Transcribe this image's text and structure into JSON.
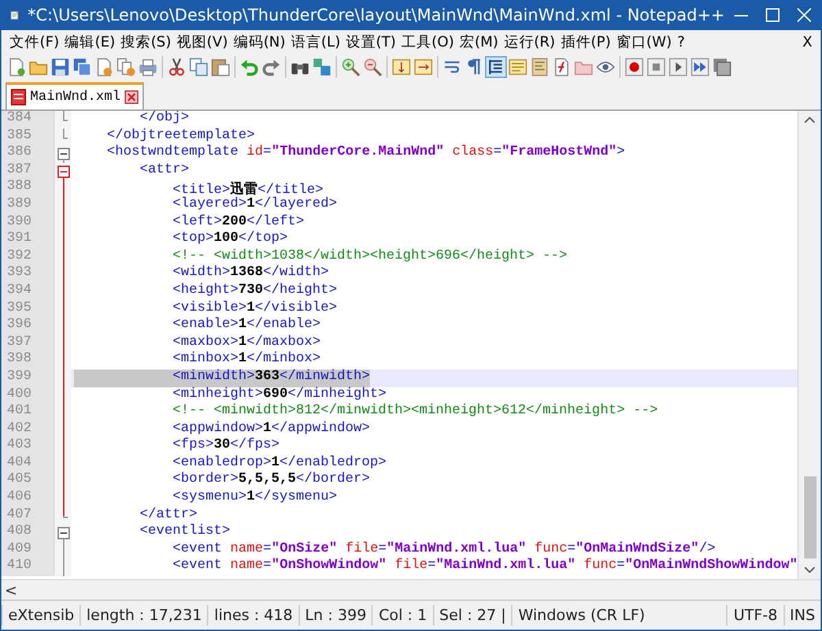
{
  "window": {
    "title": "*C:\\Users\\Lenovo\\Desktop\\ThunderCore\\layout\\MainWnd\\MainWnd.xml - Notepad++"
  },
  "menu": {
    "items": [
      {
        "label": "文件(F)"
      },
      {
        "label": "编辑(E)"
      },
      {
        "label": "搜索(S)"
      },
      {
        "label": "视图(V)"
      },
      {
        "label": "编码(N)"
      },
      {
        "label": "语言(L)"
      },
      {
        "label": "设置(T)"
      },
      {
        "label": "工具(O)"
      },
      {
        "label": "宏(M)"
      },
      {
        "label": "运行(R)"
      },
      {
        "label": "插件(P)"
      },
      {
        "label": "窗口(W)"
      },
      {
        "label": "?"
      }
    ],
    "close": "X"
  },
  "toolbar": [
    [
      {
        "kind": "new",
        "pressed": false
      },
      {
        "kind": "open",
        "pressed": false
      },
      {
        "kind": "save",
        "pressed": false
      },
      {
        "kind": "saveall",
        "pressed": false
      },
      {
        "kind": "close",
        "pressed": false
      },
      {
        "kind": "closeall",
        "pressed": false
      },
      {
        "kind": "print",
        "pressed": false
      }
    ],
    [
      {
        "kind": "cut",
        "pressed": false
      },
      {
        "kind": "copy",
        "pressed": false
      },
      {
        "kind": "paste",
        "pressed": false
      }
    ],
    [
      {
        "kind": "undo",
        "pressed": false
      },
      {
        "kind": "redo",
        "pressed": false
      }
    ],
    [
      {
        "kind": "find",
        "pressed": false
      },
      {
        "kind": "replace",
        "pressed": false
      }
    ],
    [
      {
        "kind": "zoomin",
        "pressed": false
      },
      {
        "kind": "zoomout",
        "pressed": false
      }
    ],
    [
      {
        "kind": "syncv",
        "pressed": false
      },
      {
        "kind": "synch",
        "pressed": false
      }
    ],
    [
      {
        "kind": "wrap",
        "pressed": false
      },
      {
        "kind": "pilcrow",
        "pressed": false
      },
      {
        "kind": "indent",
        "pressed": true
      },
      {
        "kind": "udl",
        "pressed": false
      },
      {
        "kind": "map",
        "pressed": false
      },
      {
        "kind": "func",
        "pressed": false
      },
      {
        "kind": "folder",
        "pressed": false
      },
      {
        "kind": "eye",
        "pressed": false
      }
    ],
    [
      {
        "kind": "record",
        "pressed": false
      },
      {
        "kind": "stop",
        "pressed": false
      },
      {
        "kind": "play",
        "pressed": false
      },
      {
        "kind": "playmulti",
        "pressed": false
      },
      {
        "kind": "savemacro",
        "pressed": false
      }
    ]
  ],
  "tabs": [
    {
      "label": "MainWnd.xml",
      "selected": true,
      "modified": true
    }
  ],
  "editor": {
    "lines": [
      {
        "number": "384",
        "kind": "end",
        "selected": false,
        "segments": [
          {
            "kind": "tag",
            "text": "        </obj>"
          }
        ]
      },
      {
        "number": "385",
        "kind": "end",
        "selected": false,
        "segments": [
          {
            "kind": "tag",
            "text": "    </objtreetemplate>"
          }
        ]
      },
      {
        "number": "386",
        "kind": "box",
        "selected": false,
        "segments": [
          {
            "kind": "tag",
            "text": "    <hostwndtemplate "
          },
          {
            "kind": "attr",
            "text": "id"
          },
          {
            "kind": "tag",
            "text": "="
          },
          {
            "kind": "value",
            "text": "\"ThunderCore.MainWnd\""
          },
          {
            "kind": "attr",
            "text": " class"
          },
          {
            "kind": "tag",
            "text": "="
          },
          {
            "kind": "value",
            "text": "\"FrameHostWnd\""
          },
          {
            "kind": "tag",
            "text": ">"
          }
        ]
      },
      {
        "number": "387",
        "kind": "boxred",
        "selected": false,
        "segments": [
          {
            "kind": "tag",
            "text": "        <attr>"
          }
        ]
      },
      {
        "number": "388",
        "kind": "barred",
        "selected": false,
        "segments": [
          {
            "kind": "tag",
            "text": "            <title>"
          },
          {
            "kind": "text",
            "text": "迅雷"
          },
          {
            "kind": "tag",
            "text": "</title>"
          }
        ]
      },
      {
        "number": "389",
        "kind": "barred",
        "selected": false,
        "segments": [
          {
            "kind": "tag",
            "text": "            <layered>"
          },
          {
            "kind": "text",
            "text": "1"
          },
          {
            "kind": "tag",
            "text": "</layered>"
          }
        ]
      },
      {
        "number": "390",
        "kind": "barred",
        "selected": false,
        "segments": [
          {
            "kind": "tag",
            "text": "            <left>"
          },
          {
            "kind": "text",
            "text": "200"
          },
          {
            "kind": "tag",
            "text": "</left>"
          }
        ]
      },
      {
        "number": "391",
        "kind": "barred",
        "selected": false,
        "segments": [
          {
            "kind": "tag",
            "text": "            <top>"
          },
          {
            "kind": "text",
            "text": "100"
          },
          {
            "kind": "tag",
            "text": "</top>"
          }
        ]
      },
      {
        "number": "392",
        "kind": "barred",
        "selected": false,
        "segments": [
          {
            "kind": "comment",
            "text": "            <!-- <width>1038</width><height>696</height> -->"
          }
        ]
      },
      {
        "number": "393",
        "kind": "barred",
        "selected": false,
        "segments": [
          {
            "kind": "tag",
            "text": "            <width>"
          },
          {
            "kind": "text",
            "text": "1368"
          },
          {
            "kind": "tag",
            "text": "</width>"
          }
        ]
      },
      {
        "number": "394",
        "kind": "barred",
        "selected": false,
        "segments": [
          {
            "kind": "tag",
            "text": "            <height>"
          },
          {
            "kind": "text",
            "text": "730"
          },
          {
            "kind": "tag",
            "text": "</height>"
          }
        ]
      },
      {
        "number": "395",
        "kind": "barred",
        "selected": false,
        "segments": [
          {
            "kind": "tag",
            "text": "            <visible>"
          },
          {
            "kind": "text",
            "text": "1"
          },
          {
            "kind": "tag",
            "text": "</visible>"
          }
        ]
      },
      {
        "number": "396",
        "kind": "barred",
        "selected": false,
        "segments": [
          {
            "kind": "tag",
            "text": "            <enable>"
          },
          {
            "kind": "text",
            "text": "1"
          },
          {
            "kind": "tag",
            "text": "</enable>"
          }
        ]
      },
      {
        "number": "397",
        "kind": "barred",
        "selected": false,
        "segments": [
          {
            "kind": "tag",
            "text": "            <maxbox>"
          },
          {
            "kind": "text",
            "text": "1"
          },
          {
            "kind": "tag",
            "text": "</maxbox>"
          }
        ]
      },
      {
        "number": "398",
        "kind": "barred",
        "selected": false,
        "segments": [
          {
            "kind": "tag",
            "text": "            <minbox>"
          },
          {
            "kind": "text",
            "text": "1"
          },
          {
            "kind": "tag",
            "text": "</minbox>"
          }
        ]
      },
      {
        "number": "399",
        "kind": "barred",
        "selected": true,
        "segments": [
          {
            "kind": "tag",
            "text": "            <minwidth>"
          },
          {
            "kind": "text",
            "text": "363"
          },
          {
            "kind": "tag",
            "text": "</minwidth>"
          }
        ]
      },
      {
        "number": "400",
        "kind": "barred",
        "selected": false,
        "segments": [
          {
            "kind": "tag",
            "text": "            <minheight>"
          },
          {
            "kind": "text",
            "text": "690"
          },
          {
            "kind": "tag",
            "text": "</minheight>"
          }
        ]
      },
      {
        "number": "401",
        "kind": "barred",
        "selected": false,
        "segments": [
          {
            "kind": "comment",
            "text": "            <!-- <minwidth>812</minwidth><minheight>612</minheight> -->"
          }
        ]
      },
      {
        "number": "402",
        "kind": "barred",
        "selected": false,
        "segments": [
          {
            "kind": "tag",
            "text": "            <appwindow>"
          },
          {
            "kind": "text",
            "text": "1"
          },
          {
            "kind": "tag",
            "text": "</appwindow>"
          }
        ]
      },
      {
        "number": "403",
        "kind": "barred",
        "selected": false,
        "segments": [
          {
            "kind": "tag",
            "text": "            <fps>"
          },
          {
            "kind": "text",
            "text": "30"
          },
          {
            "kind": "tag",
            "text": "</fps>"
          }
        ]
      },
      {
        "number": "404",
        "kind": "barred",
        "selected": false,
        "segments": [
          {
            "kind": "tag",
            "text": "            <enabledrop>"
          },
          {
            "kind": "text",
            "text": "1"
          },
          {
            "kind": "tag",
            "text": "</enabledrop>"
          }
        ]
      },
      {
        "number": "405",
        "kind": "barred",
        "selected": false,
        "segments": [
          {
            "kind": "tag",
            "text": "            <border>"
          },
          {
            "kind": "text",
            "text": "5,5,5,5"
          },
          {
            "kind": "tag",
            "text": "</border>"
          }
        ]
      },
      {
        "number": "406",
        "kind": "barred",
        "selected": false,
        "segments": [
          {
            "kind": "tag",
            "text": "            <sysmenu>"
          },
          {
            "kind": "text",
            "text": "1"
          },
          {
            "kind": "tag",
            "text": "</sysmenu>"
          }
        ]
      },
      {
        "number": "407",
        "kind": "endred",
        "selected": false,
        "segments": [
          {
            "kind": "tag",
            "text": "        </attr>"
          }
        ]
      },
      {
        "number": "408",
        "kind": "box",
        "selected": false,
        "segments": [
          {
            "kind": "tag",
            "text": "        <eventlist>"
          }
        ]
      },
      {
        "number": "409",
        "kind": "bar",
        "selected": false,
        "segments": [
          {
            "kind": "tag",
            "text": "            <event "
          },
          {
            "kind": "attr",
            "text": "name"
          },
          {
            "kind": "tag",
            "text": "="
          },
          {
            "kind": "value",
            "text": "\"OnSize\""
          },
          {
            "kind": "attr",
            "text": " file"
          },
          {
            "kind": "tag",
            "text": "="
          },
          {
            "kind": "value",
            "text": "\"MainWnd.xml.lua\""
          },
          {
            "kind": "attr",
            "text": " func"
          },
          {
            "kind": "tag",
            "text": "="
          },
          {
            "kind": "value",
            "text": "\"OnMainWndSize\""
          },
          {
            "kind": "tag",
            "text": "/>"
          }
        ]
      },
      {
        "number": "410",
        "kind": "bar",
        "selected": false,
        "segments": [
          {
            "kind": "tag",
            "text": "            <event "
          },
          {
            "kind": "attr",
            "text": "name"
          },
          {
            "kind": "tag",
            "text": "="
          },
          {
            "kind": "value",
            "text": "\"OnShowWindow\""
          },
          {
            "kind": "attr",
            "text": " file"
          },
          {
            "kind": "tag",
            "text": "="
          },
          {
            "kind": "value",
            "text": "\"MainWnd.xml.lua\""
          },
          {
            "kind": "attr",
            "text": " func"
          },
          {
            "kind": "tag",
            "text": "="
          },
          {
            "kind": "value",
            "text": "\"OnMainWndShowWindow\""
          }
        ]
      }
    ],
    "hscroll_left": "<"
  },
  "status_bar": [
    {
      "text": "eXtensib"
    },
    {
      "text": "length : 17,231"
    },
    {
      "text": "lines : 418"
    },
    {
      "text": "Ln : 399"
    },
    {
      "text": "Col : 1"
    },
    {
      "text": "Sel : 27 |"
    },
    {
      "text": "Windows (CR LF)"
    },
    {
      "text": "UTF-8"
    },
    {
      "text": "INS"
    }
  ]
}
